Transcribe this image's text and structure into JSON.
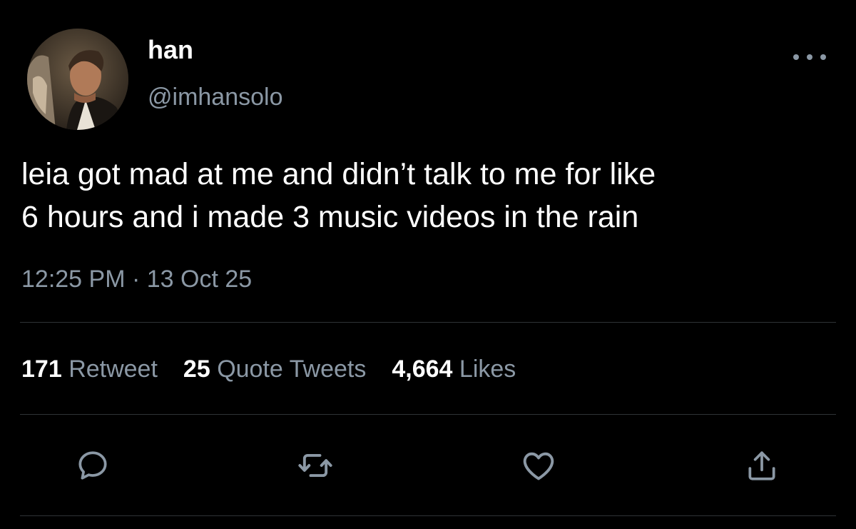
{
  "tweet": {
    "display_name": "han",
    "handle": "@imhansolo",
    "text_lines": [
      "leia got mad at me and didn’t talk to me for like",
      "6 hours and i made 3 music videos in the rain"
    ],
    "time": "12:25 PM",
    "separator": "·",
    "date": "13 Oct 25",
    "stats": [
      {
        "count": "171",
        "label": "Retweet"
      },
      {
        "count": "25",
        "label": "Quote Tweets"
      },
      {
        "count": "4,664",
        "label": "Likes"
      }
    ],
    "actions": [
      "reply-icon",
      "retweet-icon",
      "like-icon",
      "share-icon"
    ],
    "more_icon": "more-icon"
  },
  "colors": {
    "background": "#000000",
    "text": "#ffffff",
    "secondary": "#8b98a5",
    "divider": "#2f3336"
  }
}
